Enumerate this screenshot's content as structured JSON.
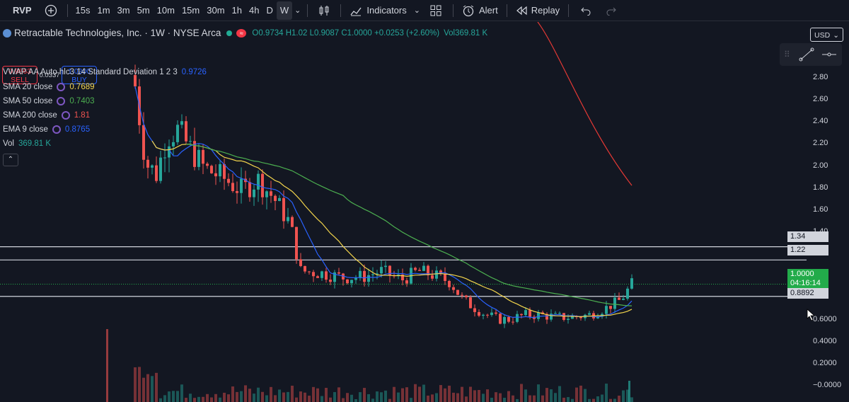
{
  "toolbar": {
    "symbol": "RVP",
    "timeframes": [
      "15s",
      "1m",
      "3m",
      "5m",
      "10m",
      "15m",
      "30m",
      "1h",
      "4h",
      "D",
      "W"
    ],
    "active_timeframe": "W",
    "indicators_label": "Indicators",
    "alert_label": "Alert",
    "replay_label": "Replay"
  },
  "legend": {
    "title": "Retractable Technologies, Inc. · 1W · NYSE Arca",
    "ohlc": "O0.9734  H1.02  L0.9087  C1.0000  +0.0253 (+2.60%)",
    "vol_inline": "Vol369.81 K",
    "sell_price": "0.9863",
    "sell_label": "SELL",
    "spread": "0.0337",
    "buy_price": "1.0200",
    "buy_label": "BUY",
    "vwap_label": "VWAP AA Auto hlc3 14 Standard Deviation 1 2 3",
    "vwap_value": "0.9726",
    "sma20_label": "SMA 20 close",
    "sma20_value": "0.7689",
    "sma50_label": "SMA 50 close",
    "sma50_value": "0.7403",
    "sma200_label": "SMA 200 close",
    "sma200_value": "1.81",
    "ema9_label": "EMA 9 close",
    "ema9_value": "0.8765",
    "vol_label": "Vol",
    "vol_value": "369.81 K"
  },
  "currency": "USD",
  "price_axis": [
    "2.80",
    "2.60",
    "2.40",
    "2.20",
    "2.00",
    "1.80",
    "1.60",
    "1.40",
    "0.6000",
    "0.4000",
    "0.2000",
    "−0.0000"
  ],
  "price_tags": {
    "level1": "1.34",
    "level2": "1.22",
    "current": "1.0000",
    "countdown": "04:16:14",
    "level3": "0.8892"
  },
  "colors": {
    "up": "#26a69a",
    "down": "#ef5350",
    "sma20": "#f2d44c",
    "sma50": "#4caf50",
    "sma200": "#e53935",
    "ema9": "#2962ff",
    "current_price": "#22ab4a"
  },
  "icons": [
    "plus-circle-icon",
    "candles-icon",
    "indicators-icon",
    "templates-icon",
    "alert-icon",
    "replay-icon",
    "undo-icon",
    "redo-icon",
    "trendline-icon",
    "hline-icon"
  ]
}
